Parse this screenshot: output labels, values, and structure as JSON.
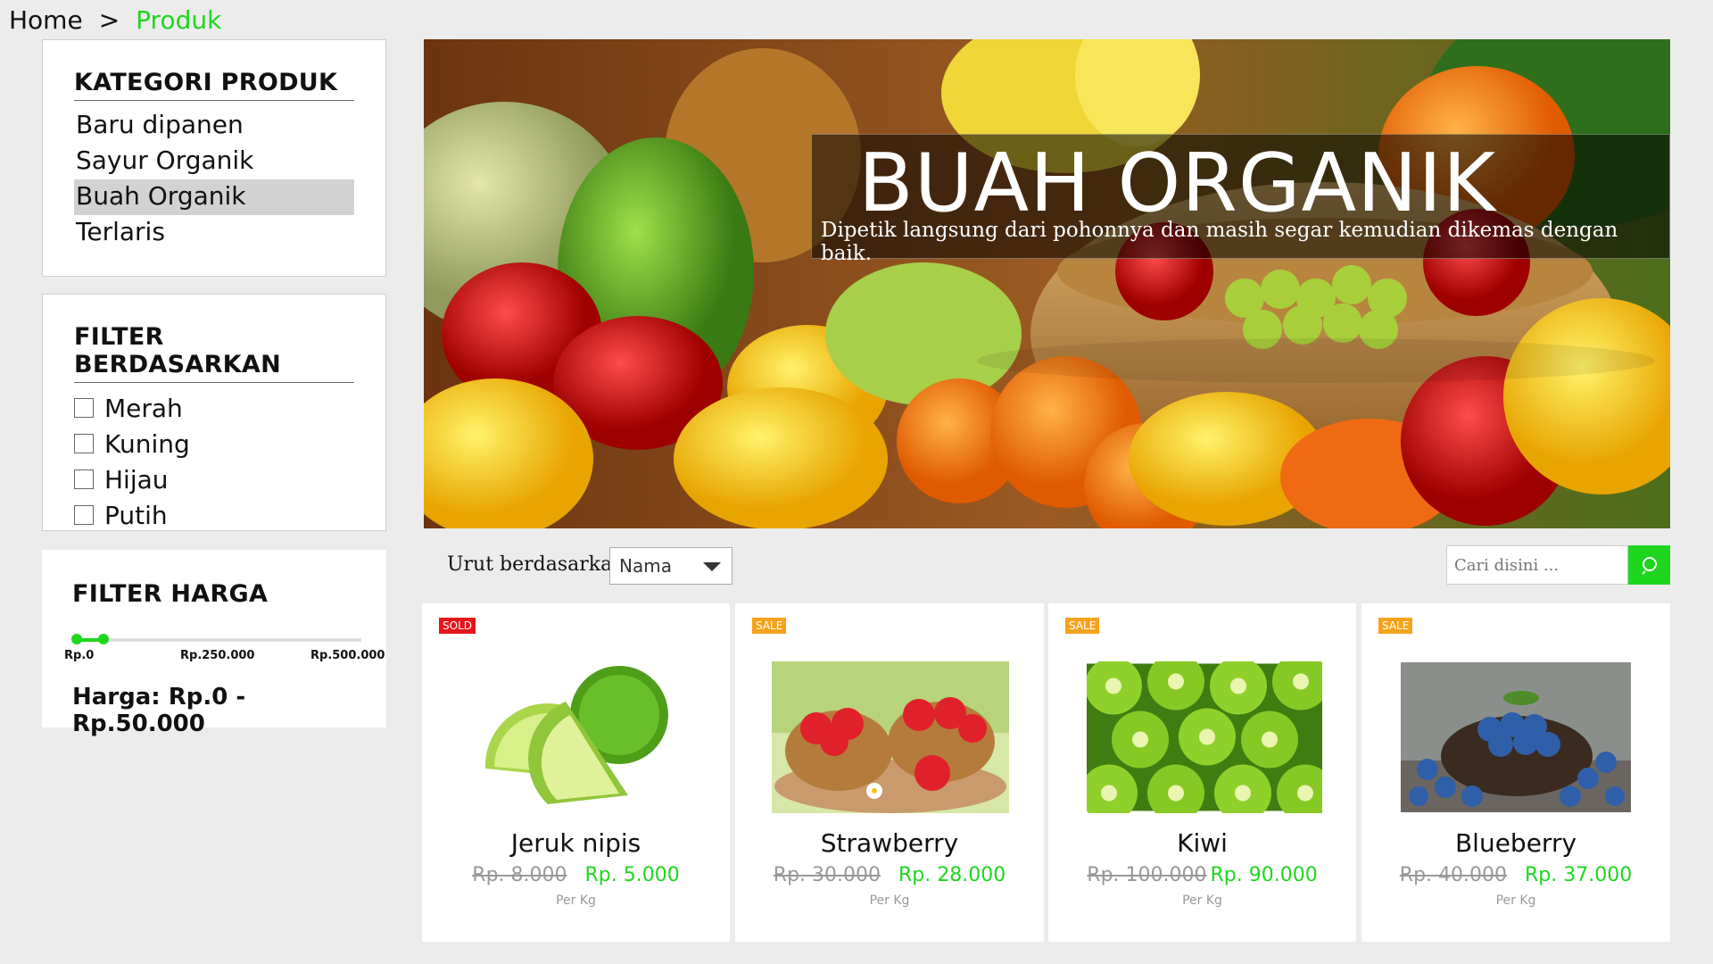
{
  "breadcrumb": {
    "home": "Home",
    "separator": ">",
    "current": "Produk"
  },
  "sidebar": {
    "categories": {
      "title": "KATEGORI PRODUK",
      "items": [
        {
          "label": "Baru dipanen",
          "active": false
        },
        {
          "label": "Sayur Organik",
          "active": false
        },
        {
          "label": "Buah Organik",
          "active": true
        },
        {
          "label": "Terlaris",
          "active": false
        }
      ]
    },
    "filter": {
      "title": "FILTER BERDASARKAN",
      "options": [
        {
          "label": "Merah",
          "checked": false
        },
        {
          "label": "Kuning",
          "checked": false
        },
        {
          "label": "Hijau",
          "checked": false
        },
        {
          "label": "Putih",
          "checked": false
        }
      ]
    },
    "price": {
      "title": "FILTER HARGA",
      "labels": [
        "Rp.0",
        "Rp.250.000",
        "Rp.500.000"
      ],
      "range_fraction": [
        0.0,
        0.1
      ],
      "text": "Harga: Rp.0 - Rp.50.000"
    }
  },
  "hero": {
    "title": "BUAH ORGANIK",
    "subtitle": "Dipetik langsung dari pohonnya dan masih segar kemudian dikemas dengan baik."
  },
  "toolbar": {
    "sort_label": "Urut berdasarkan:",
    "sort_value": "Nama",
    "search_placeholder": "Cari disini ..."
  },
  "products": [
    {
      "name": "Jeruk nipis",
      "badge": "SOLD",
      "old_price": "Rp. 8.000",
      "price": "Rp. 5.000",
      "unit": "Per Kg"
    },
    {
      "name": "Strawberry",
      "badge": "SALE",
      "old_price": "Rp. 30.000",
      "price": "Rp. 28.000",
      "unit": "Per Kg"
    },
    {
      "name": "Kiwi",
      "badge": "SALE",
      "old_price": "Rp. 100.000",
      "price": "Rp. 90.000",
      "unit": "Per Kg"
    },
    {
      "name": "Blueberry",
      "badge": "SALE",
      "old_price": "Rp. 40.000",
      "price": "Rp. 37.000",
      "unit": "Per Kg"
    }
  ],
  "colors": {
    "accent": "#1ed61e",
    "sold": "#e8141b",
    "sale": "#f6a21a"
  },
  "icons": {
    "search": "search-icon",
    "dropdown": "chevron-down-icon"
  }
}
